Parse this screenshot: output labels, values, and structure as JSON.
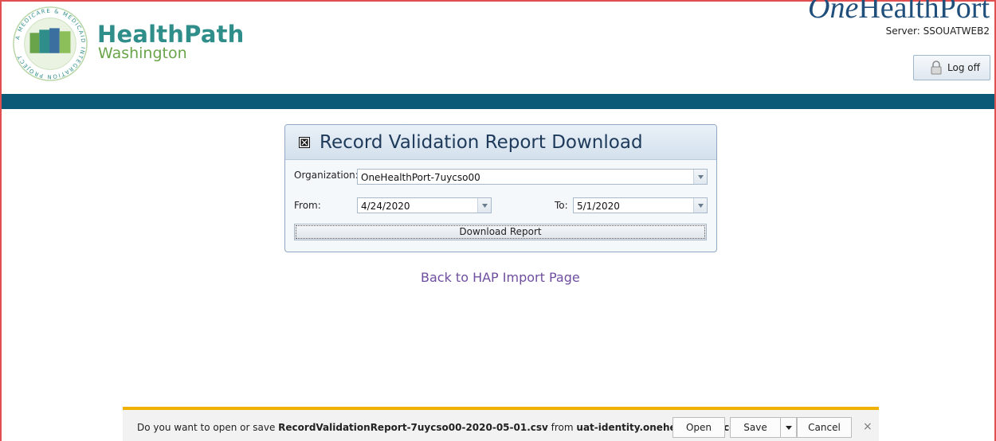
{
  "header": {
    "brand_primary": "HealthPath",
    "brand_secondary": "Washington",
    "seal_text": "A MEDICARE & MEDICAID INTEGRATION PROJECT",
    "partner_logo_one": "One",
    "partner_logo_rest": "HealthPort",
    "server_label": "Server: SSOUATWEB2",
    "logoff_label": "Log off",
    "logoff_icon": "lock-icon"
  },
  "colors": {
    "band": "#0b5877",
    "brand_teal": "#2f8e8a",
    "brand_green": "#6aa44a",
    "link": "#6f4ea0",
    "notification_accent": "#f0b000"
  },
  "panel": {
    "title": "Record Validation Report Download",
    "collapse_icon": "collapse-box-icon",
    "organization_label": "Organization:",
    "organization_value": "OneHealthPort-7uycso00",
    "from_label": "From:",
    "from_value": "4/24/2020",
    "to_label": "To:",
    "to_value": "5/1/2020",
    "download_label": "Download Report"
  },
  "back_link": "Back to HAP Import Page",
  "download_bar": {
    "prefix": "Do you want to open or save ",
    "file_name": "RecordValidationReport-7uycso00-2020-05-01.csv",
    "middle": " from ",
    "host": "uat-identity.onehealthport.com",
    "suffix": "?",
    "open_label": "Open",
    "save_label": "Save",
    "cancel_label": "Cancel",
    "close_symbol": "×"
  }
}
